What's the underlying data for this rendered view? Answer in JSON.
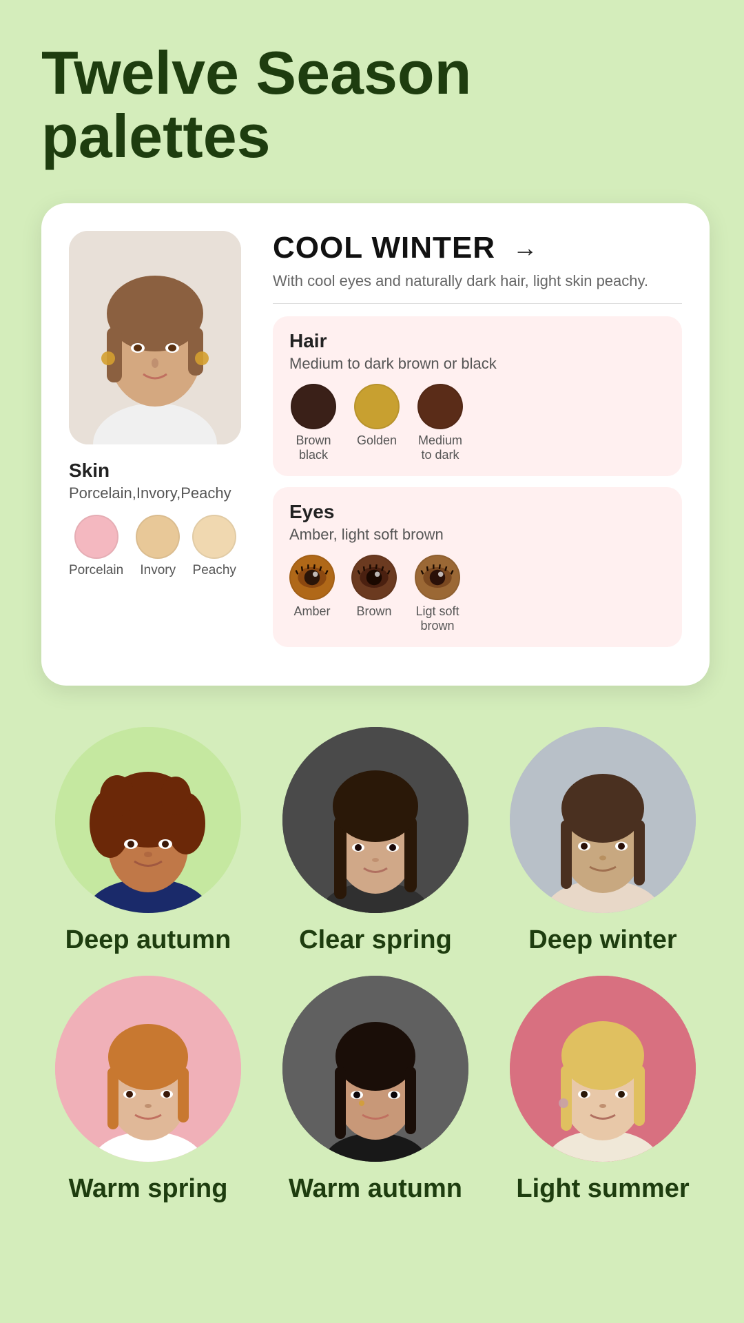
{
  "title": {
    "line1": "Twelve Season",
    "line2": "palettes"
  },
  "card": {
    "season": {
      "name": "COOL WINTER",
      "description": "With cool eyes and naturally dark hair, light skin peachy.",
      "arrow": "→"
    },
    "skin": {
      "title": "Skin",
      "subtitle": "Porcelain,Invory,Peachy",
      "swatches": [
        {
          "label": "Porcelain",
          "color": "#f4b8c0"
        },
        {
          "label": "Invory",
          "color": "#e8c898"
        },
        {
          "label": "Peachy",
          "color": "#f0d8b0"
        }
      ]
    },
    "hair": {
      "title": "Hair",
      "subtitle": "Medium to dark brown or black",
      "swatches": [
        {
          "label": "Brown black",
          "color": "#3a2018"
        },
        {
          "label": "Golden",
          "color": "#c8a030"
        },
        {
          "label": "Medium to dark",
          "color": "#5a2c18"
        }
      ]
    },
    "eyes": {
      "title": "Eyes",
      "subtitle": "Amber, light soft brown",
      "swatches": [
        {
          "label": "Amber",
          "color": "#b06818"
        },
        {
          "label": "Brown",
          "color": "#6b3a20"
        },
        {
          "label": "Ligt soft brown",
          "color": "#9b6835"
        }
      ]
    }
  },
  "persons": [
    {
      "label": "Deep autumn",
      "bg": "bg-green"
    },
    {
      "label": "Clear spring",
      "bg": "bg-dark"
    },
    {
      "label": "Deep winter",
      "bg": "bg-gray"
    },
    {
      "label": "Warm spring",
      "bg": "bg-pink"
    },
    {
      "label": "Warm autumn",
      "bg": "bg-darkgray"
    },
    {
      "label": "Light summer",
      "bg": "bg-rose"
    }
  ]
}
